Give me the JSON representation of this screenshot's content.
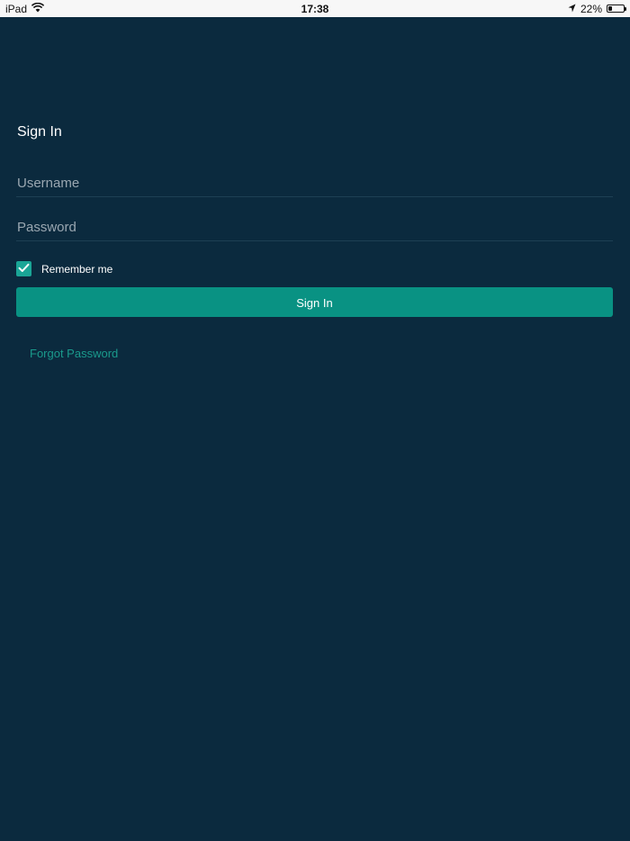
{
  "status_bar": {
    "device": "iPad",
    "time": "17:38",
    "battery_percent": "22%",
    "battery_level": 0.22,
    "icons": [
      "wifi-icon",
      "location-arrow-icon",
      "battery-icon"
    ]
  },
  "login": {
    "title": "Sign In",
    "username_placeholder": "Username",
    "password_placeholder": "Password",
    "remember_label": "Remember me",
    "remember_checked": true,
    "submit_label": "Sign In",
    "forgot_label": "Forgot Password"
  },
  "colors": {
    "background": "#0b2a3e",
    "accent": "#099283",
    "link": "#1a9a8c",
    "status_bar": "#f7f7f7"
  }
}
